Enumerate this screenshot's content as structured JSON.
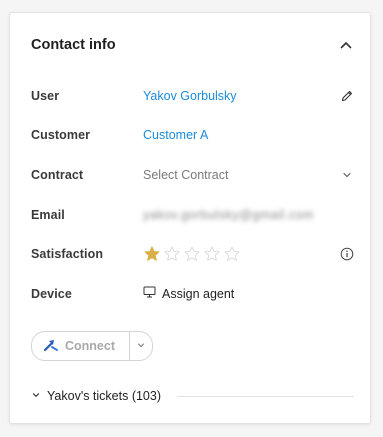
{
  "card": {
    "title": "Contact info"
  },
  "fields": {
    "user": {
      "label": "User",
      "value": "Yakov Gorbulsky"
    },
    "customer": {
      "label": "Customer",
      "value": "Customer A"
    },
    "contract": {
      "label": "Contract",
      "placeholder": "Select Contract"
    },
    "email": {
      "label": "Email",
      "value": "yakov.gorbulsky@gmail.com"
    },
    "satisfaction": {
      "label": "Satisfaction",
      "rating": 1,
      "max": 5
    },
    "device": {
      "label": "Device",
      "value": "Assign agent"
    }
  },
  "actions": {
    "connect_label": "Connect"
  },
  "tickets": {
    "label": "Yakov's tickets (103)"
  },
  "colors": {
    "link": "#1a8cd8",
    "star_filled": "#d9b04a",
    "star_empty": "#d8d8d8"
  },
  "icons": {
    "collapse": "chevron-up-icon",
    "edit": "pencil-icon",
    "contract_dropdown": "chevron-down-icon",
    "info": "info-icon",
    "device": "monitor-icon",
    "connect": "remote-connect-icon"
  }
}
